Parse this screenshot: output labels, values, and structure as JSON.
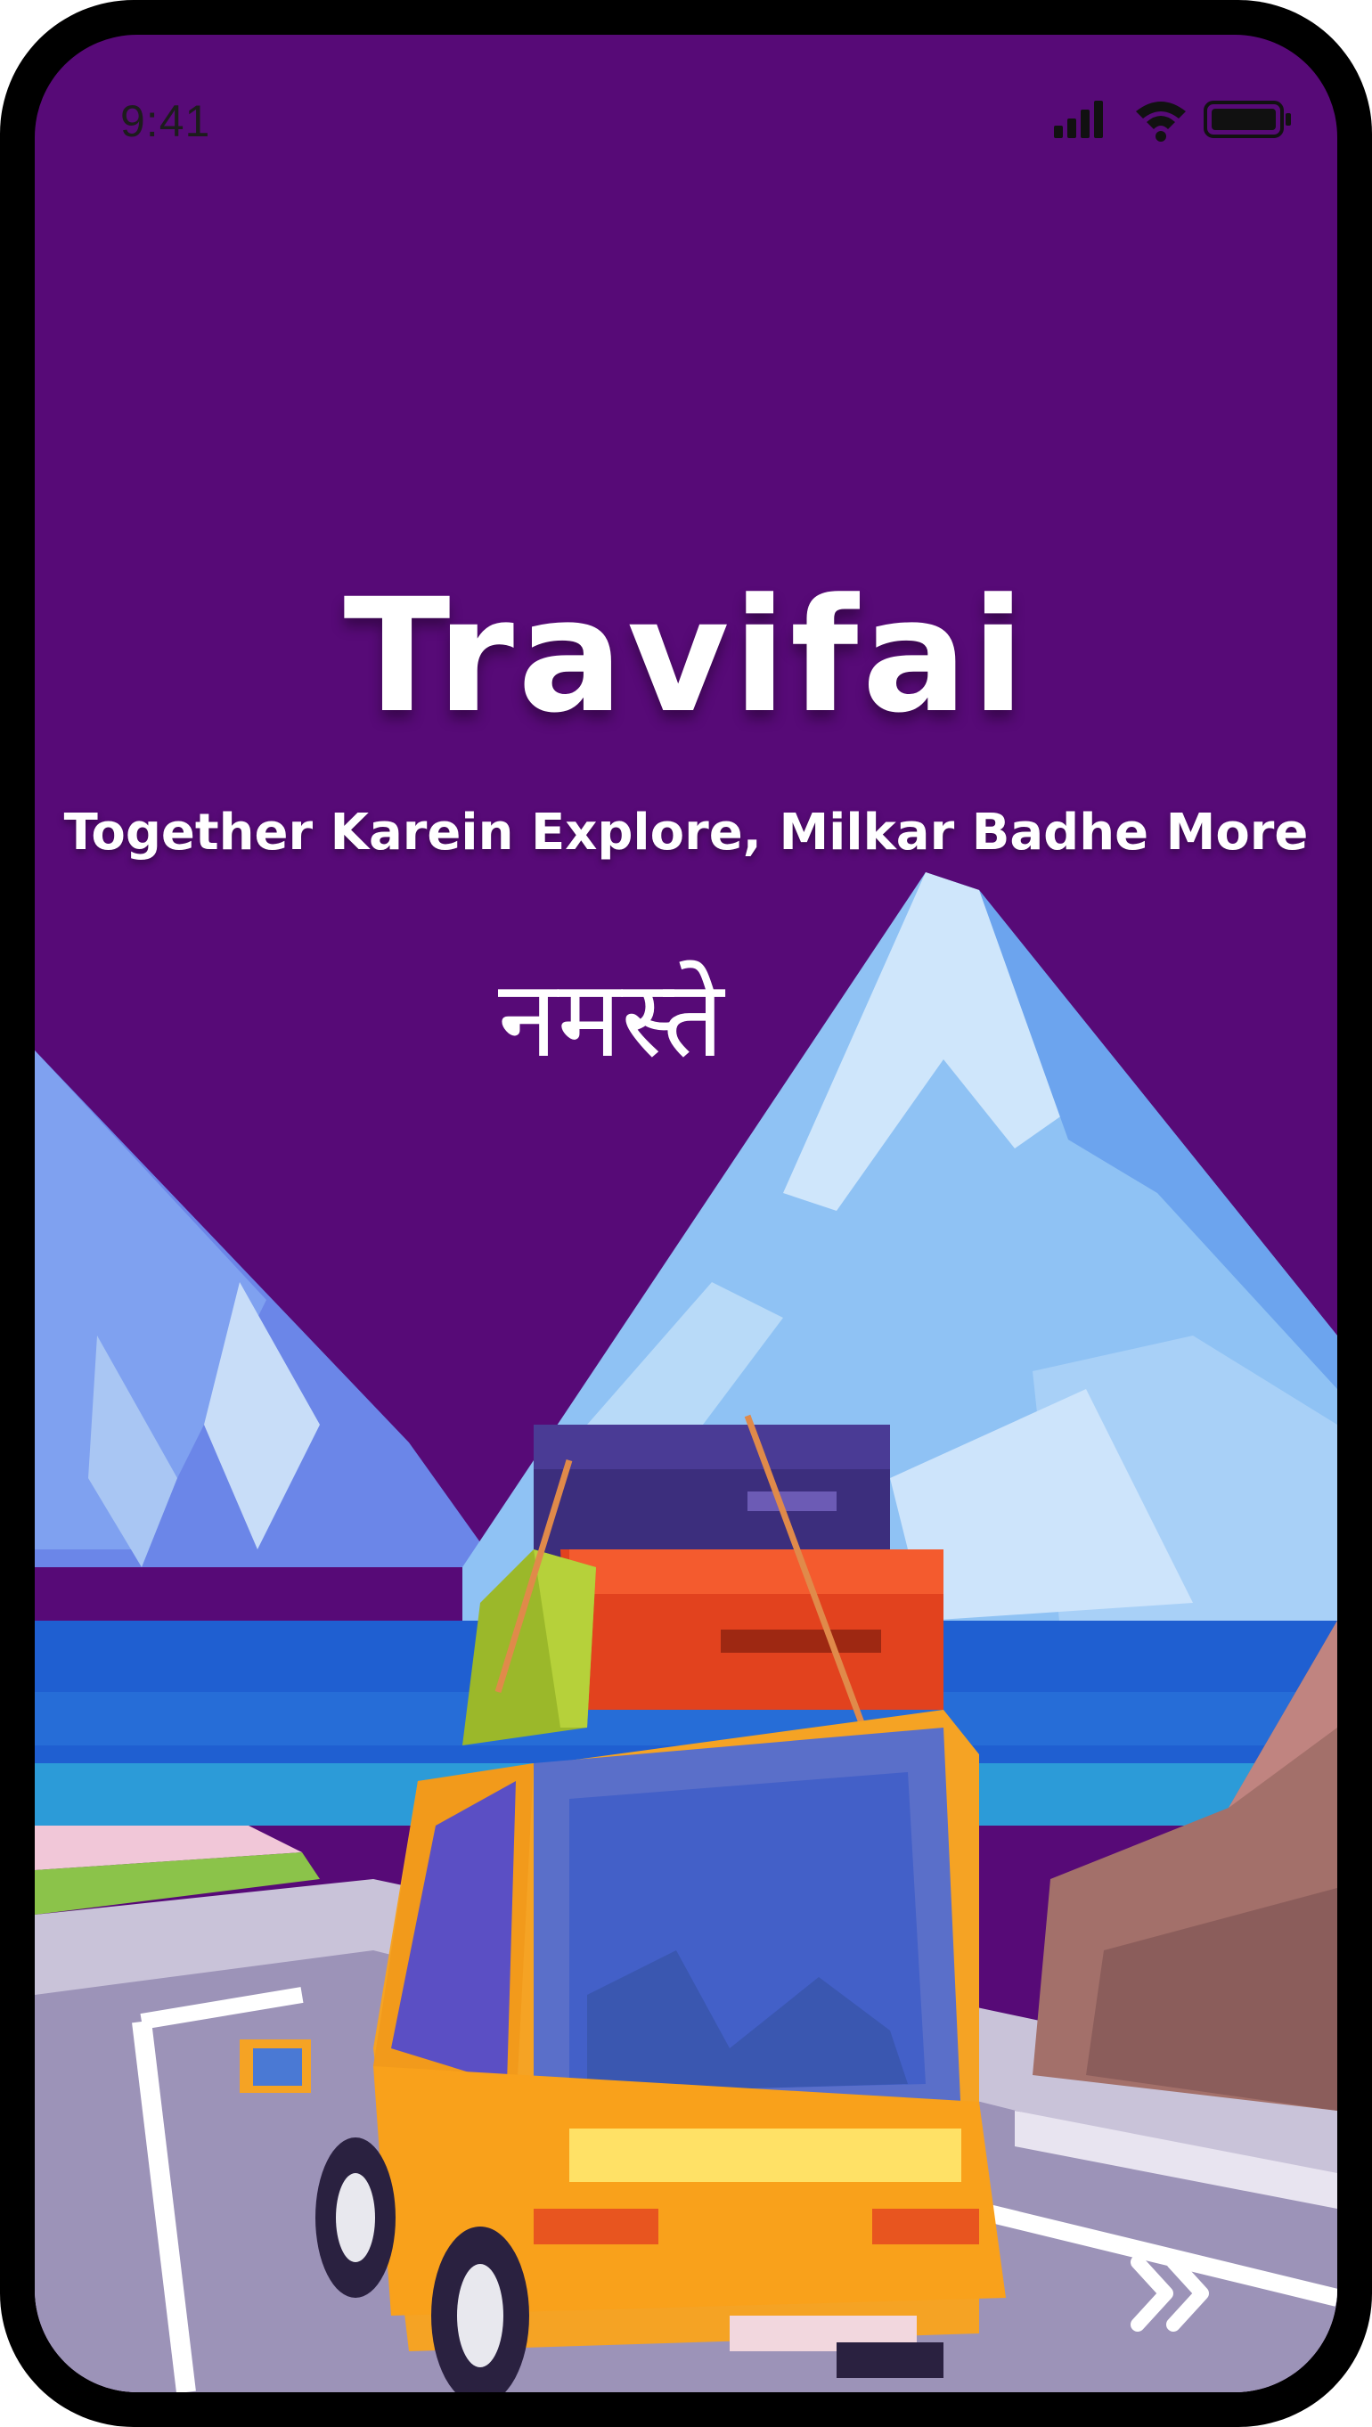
{
  "status_bar": {
    "time": "9:41",
    "icons": [
      "signal-icon",
      "wifi-icon",
      "battery-icon"
    ]
  },
  "splash": {
    "title": "Travifai",
    "tagline": "Together Karein Explore, Milkar Badhe More",
    "greeting": "नमस्ते"
  },
  "next_icon": "double-chevron-right-icon",
  "colors": {
    "background": "#570A77",
    "text": "#FFFFFF",
    "car": "#F5A324",
    "sea": "#1F5FD1",
    "mountain": "#9CCBF5"
  }
}
